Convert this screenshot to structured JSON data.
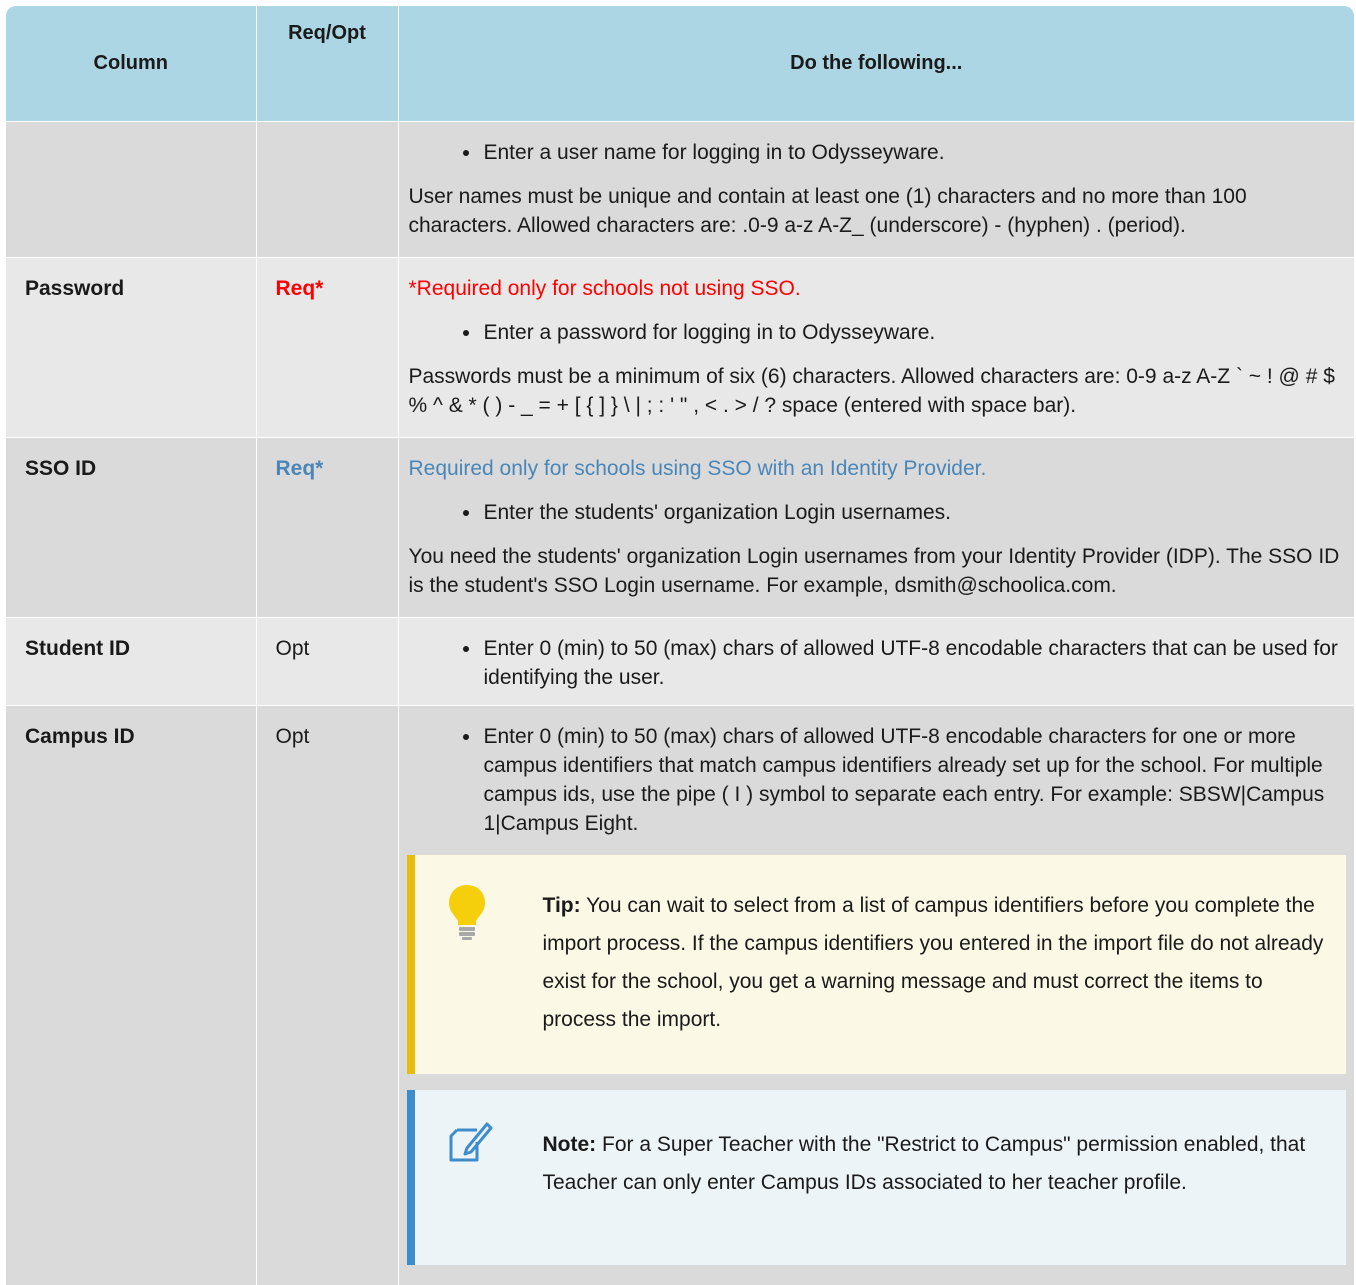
{
  "table": {
    "headers": [
      "Column",
      "Req/Opt",
      "Do the following..."
    ],
    "rows": [
      {
        "name": "",
        "req": "",
        "bullet": "Enter a user name for logging in to Odysseyware.",
        "para": "User names must be unique and contain at least one (1) characters and no more than 100 characters. Allowed characters are: .0-9 a-z A-Z_ (underscore) - (hyphen) . (period)."
      },
      {
        "name": "Password",
        "req": "Req*",
        "note": "*Required only for schools not using SSO.",
        "bullet": "Enter a password for logging in to Odysseyware.",
        "para": "Passwords must be a minimum of six (6) characters. Allowed characters are: 0-9 a-z A-Z ` ~ ! @ # $ % ^ & * ( ) - _ = + [ { ] } \\ | ; : ' \" , < . > / ? space (entered with space bar)."
      },
      {
        "name": "SSO ID",
        "req": "Req*",
        "note": "Required only for schools using SSO with an Identity Provider.",
        "bullet": "Enter the students' organization Login usernames.",
        "para": "You need the students' organization Login usernames from your Identity Provider (IDP). The SSO ID is the student's SSO Login username. For example, dsmith@schoolica.com."
      },
      {
        "name": "Student ID",
        "req": "Opt",
        "bullet": "Enter 0 (min) to 50 (max) chars of allowed UTF-8 encodable characters that can be used for identifying the user."
      },
      {
        "name": "Campus ID",
        "req": "Opt",
        "bullet": "Enter 0 (min) to 50 (max) chars of allowed UTF-8 encodable characters for one or more campus identifiers that match campus identifiers already set up for the school. For multiple campus ids, use the pipe ( I ) symbol to separate each entry. For example: SBSW|Campus 1|Campus Eight.",
        "tip": {
          "label": "Tip:",
          "text": " You can wait to select from a list of campus identifiers before you complete the import process. If the campus identifiers you entered in the import file do not already exist for the school, you get a warning message and must correct the items to process the import."
        },
        "note_box": {
          "label": "Note:",
          "text": " For a Super Teacher with the \"Restrict to Campus\" permission enabled, that Teacher can only enter Campus IDs associated to her teacher profile."
        }
      }
    ]
  },
  "icons": {
    "tip": "lightbulb-icon",
    "note": "note-pencil-icon"
  },
  "colors": {
    "header_bg": "#acd6e3",
    "row_bg": "#dadada",
    "row_alt_bg": "#e8e8e8",
    "required_red": "#ff0000",
    "required_blue": "#4a86b8",
    "tip_border": "#e6be0a",
    "note_border": "#3d8dcc"
  }
}
